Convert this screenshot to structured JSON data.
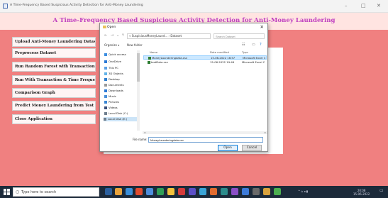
{
  "window": {
    "title": "A Time-Frequency Based Suspicious Activity Detection for Anti-Money Laundering",
    "controls": [
      "–",
      "□",
      "✕"
    ]
  },
  "app": {
    "heading": "A Time-Frequency Based Suspicious Activity Detection for Anti-Money Laundering",
    "buttons": [
      "Upload Anti-Money Laundering Dataset",
      "Preprocess Dataset",
      "Run Random Forest with Transaction",
      "Run With Transaction & Time Frequency",
      "Comparison Graph",
      "Predict Money Laundering from Test Data",
      "Close Application"
    ],
    "colors": {
      "background": "#f08080",
      "banner": "#ffe4e1",
      "heading": "#c040c0"
    }
  },
  "dialog": {
    "title": "Open",
    "path": "« SuspiciousMoneyLaund... › Dataset",
    "search_placeholder": "Search Dataset",
    "organize_label": "Organize ▾",
    "new_folder_label": "New folder",
    "nav_items": [
      {
        "label": "Quick access",
        "icon": "star-icon"
      },
      {
        "label": "OneDrive",
        "icon": "cloud-icon"
      },
      {
        "label": "This PC",
        "icon": "computer-icon"
      },
      {
        "label": "3D Objects",
        "icon": "cube-icon"
      },
      {
        "label": "Desktop",
        "icon": "desktop-icon"
      },
      {
        "label": "Documents",
        "icon": "document-icon"
      },
      {
        "label": "Downloads",
        "icon": "download-icon"
      },
      {
        "label": "Music",
        "icon": "music-icon"
      },
      {
        "label": "Pictures",
        "icon": "picture-icon"
      },
      {
        "label": "Videos",
        "icon": "video-icon"
      },
      {
        "label": "Local Disk (C:)",
        "icon": "disk-icon"
      },
      {
        "label": "Local Disk (E:)",
        "icon": "disk-icon"
      }
    ],
    "columns": [
      "Name",
      "Date modified",
      "Type"
    ],
    "files": [
      {
        "name": "MoneyLaunderingdata.csv",
        "date": "15-06-2022 16:57",
        "type": "Microsoft Excel C"
      },
      {
        "name": "testData.csv",
        "date": "15-06-2022 19:46",
        "type": "Microsoft Excel C"
      }
    ],
    "file_name_label": "File name:",
    "file_name_value": "MoneyLaunderingdata.csv",
    "open_label": "Open",
    "cancel_label": "Cancel"
  },
  "taskbar": {
    "search_placeholder": "Type here to search",
    "clock": "20:08",
    "date": "15-06-2022"
  }
}
